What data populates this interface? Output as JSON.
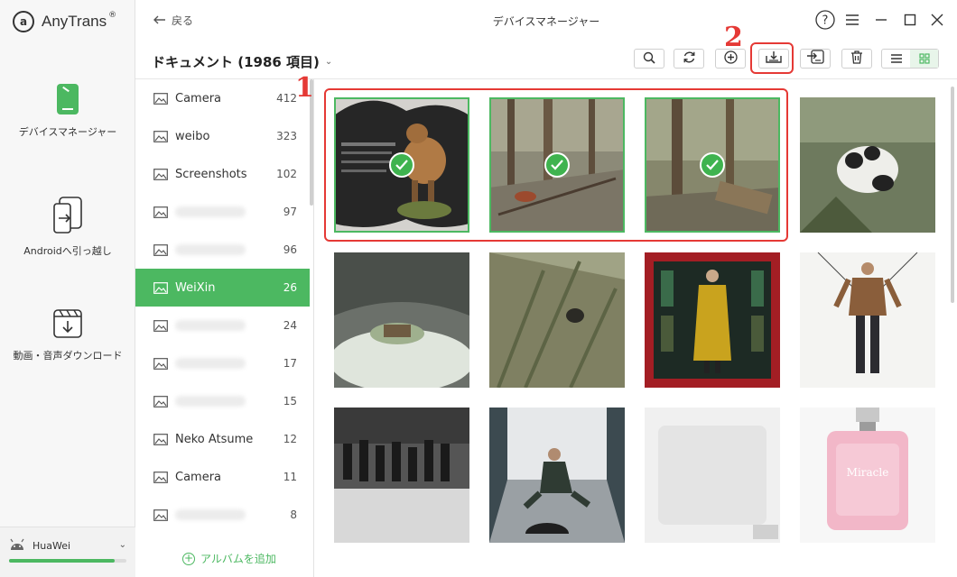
{
  "app": {
    "name": "AnyTrans",
    "reg": "®"
  },
  "rail": {
    "items": [
      {
        "label": "デバイスマネージャー",
        "icon": "phone-icon"
      },
      {
        "label": "Androidへ引っ越し",
        "icon": "transfer-phone-icon"
      },
      {
        "label": "動画・音声ダウンロード",
        "icon": "download-video-icon"
      }
    ]
  },
  "device": {
    "name": "HuaWei",
    "icon": "android-icon",
    "storage_used": 0.9
  },
  "titlebar": {
    "back_label": "戻る",
    "title": "デバイスマネージャー"
  },
  "toolbar": {
    "doc_title": "ドキュメント (1986 項目)"
  },
  "albums": [
    {
      "name": "Camera",
      "count": "412",
      "blurred": false
    },
    {
      "name": "weibo",
      "count": "323",
      "blurred": false
    },
    {
      "name": "Screenshots",
      "count": "102",
      "blurred": false
    },
    {
      "name": "",
      "count": "97",
      "blurred": true
    },
    {
      "name": "",
      "count": "96",
      "blurred": true
    },
    {
      "name": "WeiXin",
      "count": "26",
      "blurred": false,
      "active": true
    },
    {
      "name": "",
      "count": "24",
      "blurred": true
    },
    {
      "name": "",
      "count": "17",
      "blurred": true
    },
    {
      "name": "",
      "count": "15",
      "blurred": true
    },
    {
      "name": "Neko Atsume",
      "count": "12",
      "blurred": false
    },
    {
      "name": "Camera",
      "count": "11",
      "blurred": false
    },
    {
      "name": "",
      "count": "8",
      "blurred": true
    }
  ],
  "add_album_label": "アルバムを追加",
  "annotations": {
    "step1": "1",
    "step2": "2"
  },
  "colors": {
    "accent": "#4cb861",
    "annotation": "#e53935"
  }
}
